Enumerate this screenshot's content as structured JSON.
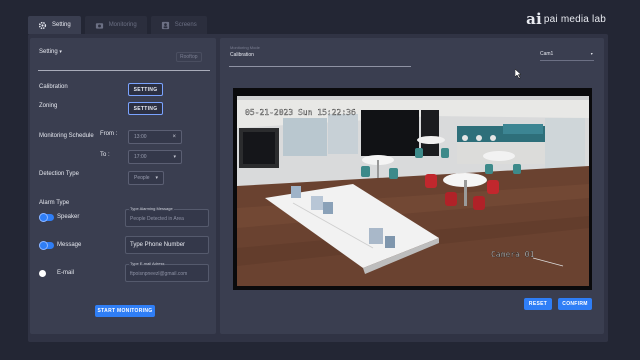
{
  "tabs": [
    {
      "label": "Setting",
      "icon": "gear-icon",
      "active": true
    },
    {
      "label": "Monitoring",
      "icon": "camera-icon",
      "active": false
    },
    {
      "label": "Screens",
      "icon": "user-icon",
      "active": false
    }
  ],
  "brand": {
    "mark": "ai",
    "text": "pai media lab",
    "name": "ai media lab"
  },
  "left": {
    "setting_menu": "Setting",
    "setting_menu_right": "Rooftop",
    "calibration_label": "Calibration",
    "zoning_label": "Zoning",
    "setting_button": "SETTING",
    "monitoring_schedule_label": "Monitoring Schedule",
    "from_label": "From :",
    "to_label": "To :",
    "from_value": "13:00",
    "to_value": "17:00",
    "detection_type_label": "Detection Type",
    "detection_type_value": "People",
    "alarm_type_label": "Alarm Type",
    "speaker_label": "Speaker",
    "message_label": "Message",
    "email_label": "E-mail",
    "alarming_message_caption": "Type Alarming Message",
    "alarming_message_value": "People Detected in Area",
    "phone_placeholder": "Type Phone Number",
    "email_caption": "Type E-mail Adress",
    "email_value": "ftpoisnpneezl@gmail.com",
    "start_button": "START MONITORING"
  },
  "right": {
    "mode_caption": "Monitoring Mode",
    "mode_value": "Calibration",
    "camera_select": "Cam1",
    "camera_timestamp": "05-21-2023 Sun 15:22:36",
    "camera_label": "Camera 01",
    "reset_button": "RESET",
    "confirm_button": "CONFIRM"
  },
  "colors": {
    "accent": "#2f7ef6",
    "background": "#232634",
    "panel": "#3a3e50"
  }
}
